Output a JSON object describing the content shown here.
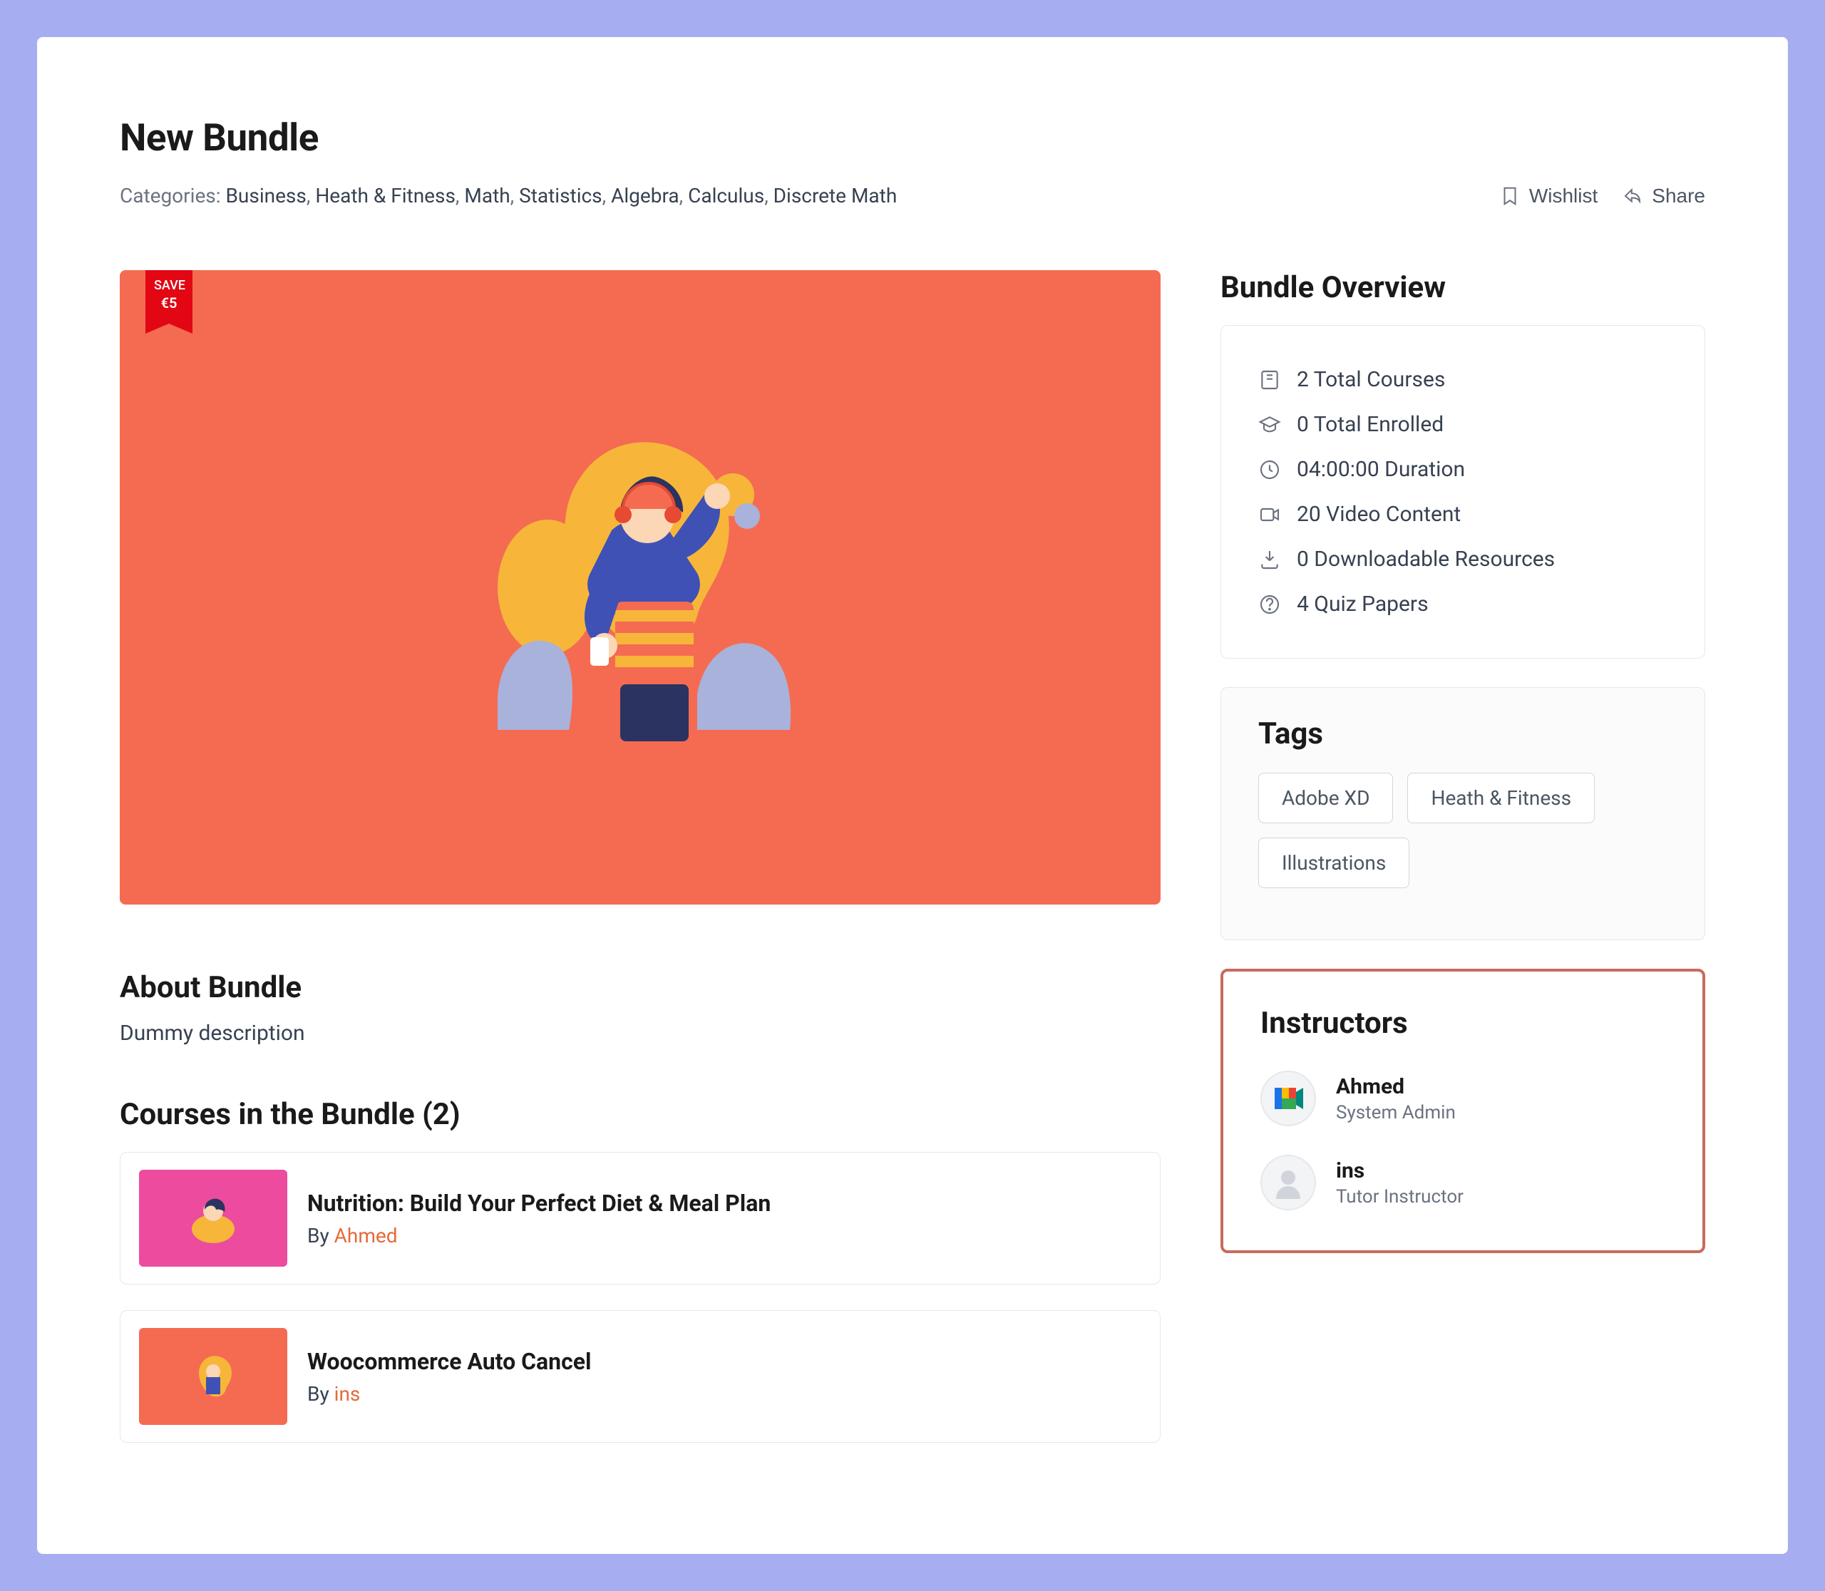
{
  "header": {
    "title": "New Bundle",
    "categories_prefix": "Categories: ",
    "categories": [
      "Business",
      "Heath & Fitness",
      "Math",
      "Statistics",
      "Algebra",
      "Calculus",
      "Discrete Math"
    ]
  },
  "actions": {
    "wishlist": "Wishlist",
    "share": "Share"
  },
  "ribbon": {
    "label": "SAVE",
    "amount": "€5"
  },
  "about": {
    "heading": "About Bundle",
    "description": "Dummy description"
  },
  "courses": {
    "heading_prefix": "Courses in the Bundle",
    "count_display": "(2)",
    "by_label": "By",
    "list": [
      {
        "title": "Nutrition: Build Your Perfect Diet & Meal Plan",
        "author": "Ahmed",
        "thumb": "pink"
      },
      {
        "title": "Woocommerce Auto Cancel",
        "author": "ins",
        "thumb": "orange"
      }
    ]
  },
  "overview": {
    "heading": "Bundle Overview",
    "items": [
      {
        "icon": "book",
        "text": "2 Total Courses"
      },
      {
        "icon": "gradcap",
        "text": "0 Total Enrolled"
      },
      {
        "icon": "clock",
        "text": "04:00:00 Duration"
      },
      {
        "icon": "video",
        "text": "20 Video Content"
      },
      {
        "icon": "download",
        "text": "0 Downloadable Resources"
      },
      {
        "icon": "question",
        "text": "4 Quiz Papers"
      }
    ]
  },
  "tags": {
    "heading": "Tags",
    "list": [
      "Adobe XD",
      "Heath & Fitness",
      "Illustrations"
    ]
  },
  "instructors": {
    "heading": "Instructors",
    "list": [
      {
        "name": "Ahmed",
        "role": "System Admin",
        "avatar": "meet"
      },
      {
        "name": "ins",
        "role": "Tutor Instructor",
        "avatar": "default"
      }
    ]
  }
}
